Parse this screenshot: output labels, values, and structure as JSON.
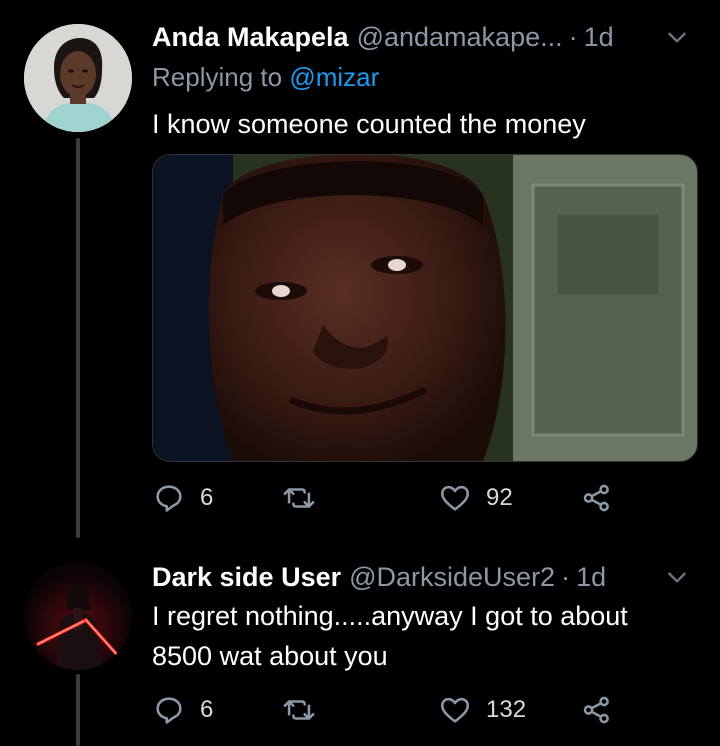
{
  "tweets": [
    {
      "display_name": "Anda Makapela",
      "handle": "@andamakape...",
      "time": "1d",
      "replying_label": "Replying to",
      "replying_to": "@mizar",
      "text": "I know someone counted the money",
      "counts": {
        "replies": "6",
        "retweets": "",
        "likes": "92"
      }
    },
    {
      "display_name": "Dark side User",
      "handle": "@DarksideUser2",
      "time": "1d",
      "text": "I regret nothing.....anyway I got to about 8500 wat about you",
      "counts": {
        "replies": "6",
        "retweets": "",
        "likes": "132"
      }
    }
  ],
  "icons": {
    "reply": "reply-icon",
    "retweet": "retweet-icon",
    "like": "heart-icon",
    "share": "share-icon",
    "more": "chevron-down-icon"
  },
  "colors": {
    "background": "#000000",
    "muted": "#8b98a5",
    "link": "#1d9bf0"
  }
}
